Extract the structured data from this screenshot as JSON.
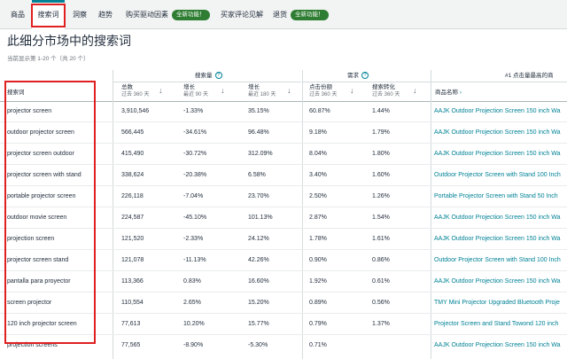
{
  "tabs": [
    {
      "label": "商品"
    },
    {
      "label": "搜索词"
    },
    {
      "label": "洞察"
    },
    {
      "label": "趋势"
    },
    {
      "label": "购买驱动因素",
      "badge": "全新功能！"
    },
    {
      "label": "买家评论见解"
    },
    {
      "label": "退货",
      "badge": "全新功能！"
    }
  ],
  "page_title": "此细分市场中的搜索词",
  "showing": "当前显示第 1-20 个（共 20 个）",
  "groups": {
    "search_volume": "搜索量",
    "demand": "需求",
    "top_clicked": "#1 点击量最高的商"
  },
  "columns": {
    "keyword": "搜索词",
    "total": "总数",
    "total_sub": "过去 360 天",
    "growth90": "增长",
    "growth90_sub": "最近 90 天",
    "growth180": "增长",
    "growth180_sub": "最近 180 天",
    "click_share": "点击份额",
    "click_share_sub": "过去 360 天",
    "conversion": "搜索转化",
    "conversion_sub": "过去 360 天",
    "product_name": "商品名称",
    "product_arrow": "›"
  },
  "rows": [
    {
      "keyword": "projector screen",
      "total": "3,910,546",
      "g90": "-1.33%",
      "g180": "35.15%",
      "click": "60.87%",
      "conv": "1.44%",
      "product": "AAJK Outdoor Projection Screen 150 inch Wa"
    },
    {
      "keyword": "outdoor projector screen",
      "total": "566,445",
      "g90": "-34.61%",
      "g180": "96.48%",
      "click": "9.18%",
      "conv": "1.79%",
      "product": "AAJK Outdoor Projection Screen 150 inch Wa"
    },
    {
      "keyword": "projector screen outdoor",
      "total": "415,490",
      "g90": "-30.72%",
      "g180": "312.09%",
      "click": "8.04%",
      "conv": "1.80%",
      "product": "AAJK Outdoor Projection Screen 150 inch Wa"
    },
    {
      "keyword": "projector screen with stand",
      "total": "338,624",
      "g90": "-20.38%",
      "g180": "6.58%",
      "click": "3.40%",
      "conv": "1.60%",
      "product": "Outdoor Projector Screen with Stand 100 Inch"
    },
    {
      "keyword": "portable projector screen",
      "total": "226,118",
      "g90": "-7.04%",
      "g180": "23.70%",
      "click": "2.50%",
      "conv": "1.26%",
      "product": "Portable Projector Screen with Stand 50 Inch"
    },
    {
      "keyword": "outdoor movie screen",
      "total": "224,587",
      "g90": "-45.10%",
      "g180": "101.13%",
      "click": "2.87%",
      "conv": "1.54%",
      "product": "AAJK Outdoor Projection Screen 150 inch Wa"
    },
    {
      "keyword": "projection screen",
      "total": "121,520",
      "g90": "-2.33%",
      "g180": "24.12%",
      "click": "1.78%",
      "conv": "1.61%",
      "product": "AAJK Outdoor Projection Screen 150 inch Wa"
    },
    {
      "keyword": "projector screen stand",
      "total": "121,078",
      "g90": "-11.13%",
      "g180": "42.26%",
      "click": "0.90%",
      "conv": "0.86%",
      "product": "Outdoor Projector Screen with Stand 100 Inch"
    },
    {
      "keyword": "pantalla para proyector",
      "total": "113,366",
      "g90": "0.83%",
      "g180": "16.60%",
      "click": "1.92%",
      "conv": "0.61%",
      "product": "AAJK Outdoor Projection Screen 150 inch Wa"
    },
    {
      "keyword": "screen projector",
      "total": "110,554",
      "g90": "2.65%",
      "g180": "15.20%",
      "click": "0.89%",
      "conv": "0.56%",
      "product": "TMY Mini Projector Upgraded Bluetooth Proje"
    },
    {
      "keyword": "120 inch projector screen",
      "total": "77,613",
      "g90": "10.20%",
      "g180": "15.77%",
      "click": "0.79%",
      "conv": "1.37%",
      "product": "Projector Screen and Stand Towond 120 inch"
    },
    {
      "keyword": "projection screens",
      "total": "77,565",
      "g90": "-8.90%",
      "g180": "-5.30%",
      "click": "0.71%",
      "conv": "",
      "product": "AAJK Outdoor Projection Screen 150 inch Wa"
    }
  ]
}
